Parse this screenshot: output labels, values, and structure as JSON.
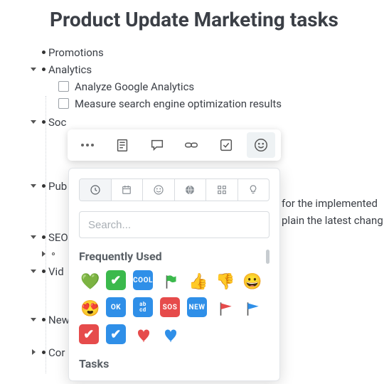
{
  "title": "Product Update Marketing tasks",
  "outline": {
    "promotions": "Promotions",
    "analytics": "Analytics",
    "analytics_children": [
      "Analyze Google Analytics",
      "Measure search engine optimization results"
    ],
    "social": "Soc",
    "publications": "Pub",
    "pub_lines": [
      "for the implemented",
      "plain the latest chang"
    ],
    "seo": "SEO",
    "video": "Vid",
    "newsletter": "New",
    "content": "Cor"
  },
  "toolbar": {
    "more": "more",
    "note": "note",
    "comment": "comment",
    "link": "link",
    "task": "task",
    "emoji": "emoji"
  },
  "emoji_panel": {
    "search_placeholder": "Search...",
    "section_recent": "Frequently Used",
    "section_tasks": "Tasks",
    "tabs": [
      "recent",
      "date",
      "smileys",
      "sports",
      "symbols",
      "idea"
    ],
    "recent": [
      {
        "name": "green-heart",
        "glyph": "💚"
      },
      {
        "name": "check-green",
        "glyph": "✅"
      },
      {
        "name": "cool-box",
        "glyph": "COOL"
      },
      {
        "name": "flag-green",
        "glyph": "flag"
      },
      {
        "name": "thumbs-up",
        "glyph": "👍"
      },
      {
        "name": "thumbs-down",
        "glyph": "👎"
      },
      {
        "name": "grinning",
        "glyph": "😀"
      },
      {
        "name": "heart-eyes",
        "glyph": "😍"
      },
      {
        "name": "ok-box",
        "glyph": "OK"
      },
      {
        "name": "abcd-box",
        "glyph": "abcd"
      },
      {
        "name": "sos-box",
        "glyph": "SOS"
      },
      {
        "name": "new-box",
        "glyph": "NEW"
      },
      {
        "name": "flag-red",
        "glyph": "flag"
      },
      {
        "name": "flag-blue",
        "glyph": "flag"
      },
      {
        "name": "check-red",
        "glyph": "✔"
      },
      {
        "name": "check-blue",
        "glyph": "✔"
      },
      {
        "name": "heart-red",
        "glyph": "❤"
      },
      {
        "name": "heart-blue",
        "glyph": "💙"
      }
    ]
  }
}
